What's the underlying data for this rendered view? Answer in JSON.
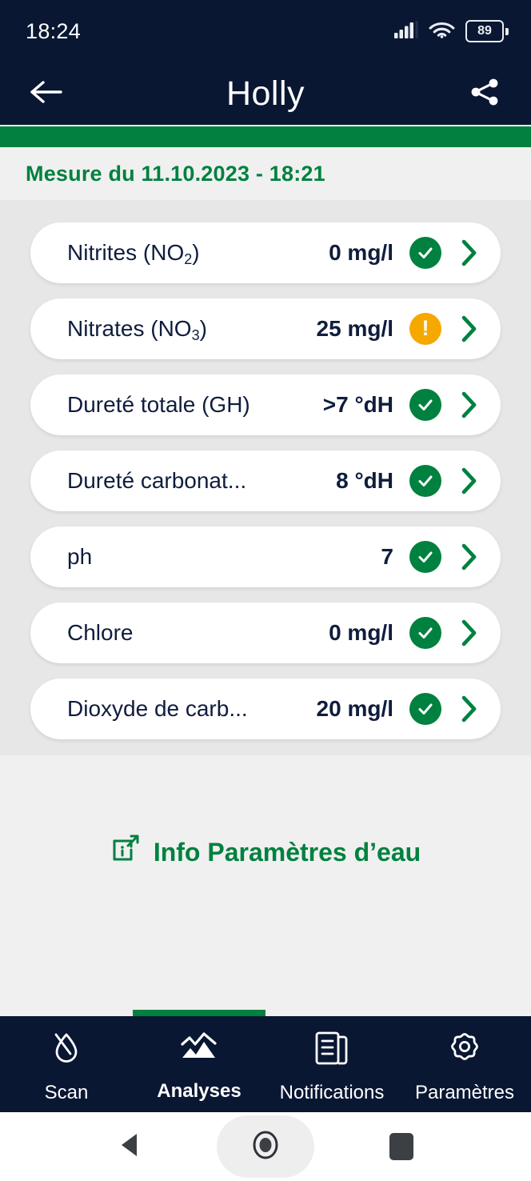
{
  "status_bar": {
    "time": "18:24",
    "signal_icon": "cellular-signal-icon",
    "wifi_icon": "wifi-icon",
    "battery_level": "89"
  },
  "app_bar": {
    "back_icon": "back-arrow-icon",
    "title": "Holly",
    "share_icon": "share-icon"
  },
  "measurement": {
    "header": "Mesure du 11.10.2023 - 18:21"
  },
  "parameters": [
    {
      "label": "Nitrites (NO",
      "sub": "2",
      "label_end": ")",
      "value": "0 mg/l",
      "status": "ok",
      "status_icon": "check-circle-icon"
    },
    {
      "label": "Nitrates (NO",
      "sub": "3",
      "label_end": ")",
      "value": "25 mg/l",
      "status": "warn",
      "status_icon": "warning-circle-icon"
    },
    {
      "label": "Dureté totale (GH)",
      "sub": "",
      "label_end": "",
      "value": ">7 °dH",
      "status": "ok",
      "status_icon": "check-circle-icon"
    },
    {
      "label": "Dureté carbonat...",
      "sub": "",
      "label_end": "",
      "value": "8 °dH",
      "status": "ok",
      "status_icon": "check-circle-icon"
    },
    {
      "label": "ph",
      "sub": "",
      "label_end": "",
      "value": "7",
      "status": "ok",
      "status_icon": "check-circle-icon"
    },
    {
      "label": "Chlore",
      "sub": "",
      "label_end": "",
      "value": "0 mg/l",
      "status": "ok",
      "status_icon": "check-circle-icon"
    },
    {
      "label": "Dioxyde de carb...",
      "sub": "",
      "label_end": "",
      "value": "20 mg/l",
      "status": "ok",
      "status_icon": "check-circle-icon"
    }
  ],
  "info_link": {
    "icon": "info-external-link-icon",
    "label": "Info Paramètres d’eau"
  },
  "bottom_nav": {
    "items": [
      {
        "label": "Scan",
        "icon": "water-drop-slash-icon",
        "active": false
      },
      {
        "label": "Analyses",
        "icon": "chart-mountain-icon",
        "active": true
      },
      {
        "label": "Notifications",
        "icon": "document-lines-icon",
        "active": false
      },
      {
        "label": "Paramètres",
        "icon": "gear-icon",
        "active": false
      }
    ]
  },
  "system_nav": {
    "back_icon": "android-back-triangle-icon",
    "home_icon": "android-home-circle-icon",
    "recents_icon": "android-recents-square-icon"
  },
  "colors": {
    "header_navy": "#0a1733",
    "brand_green": "#00813f",
    "warning_orange": "#f5a800",
    "text_navy": "#0f1d3d",
    "list_bg": "#e7e7e7",
    "page_bg": "#f0f0f0"
  }
}
